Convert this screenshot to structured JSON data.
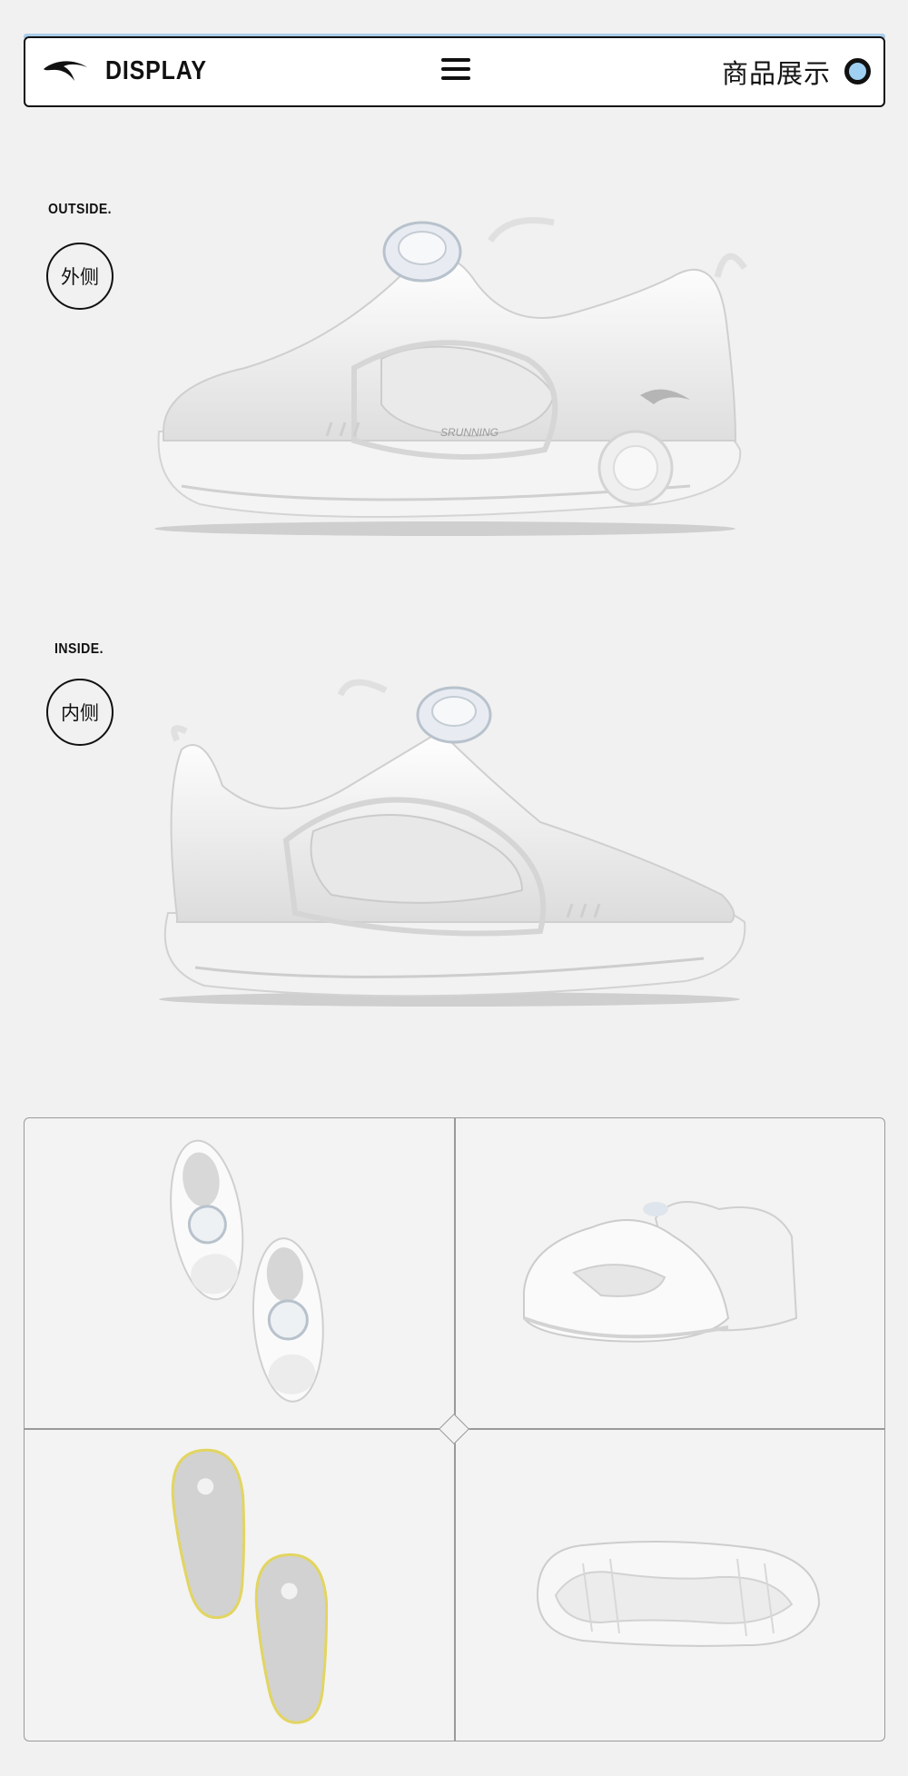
{
  "header": {
    "brand_label": "DISPLAY",
    "title_cn": "商品展示",
    "logo_icon": "anta-logo-icon",
    "menu_icon": "hamburger-menu-icon",
    "ring_icon": "circle-indicator-icon",
    "accent_color": "#a9cde9"
  },
  "sections": {
    "outside": {
      "label_en": "OUTSIDE.",
      "label_cn": "外侧"
    },
    "inside": {
      "label_en": "INSIDE.",
      "label_cn": "内侧"
    }
  },
  "shoe_text": "SRUNNING",
  "gallery": {
    "cells": [
      "top-view",
      "back-view",
      "insoles-view",
      "outsole-view"
    ]
  }
}
